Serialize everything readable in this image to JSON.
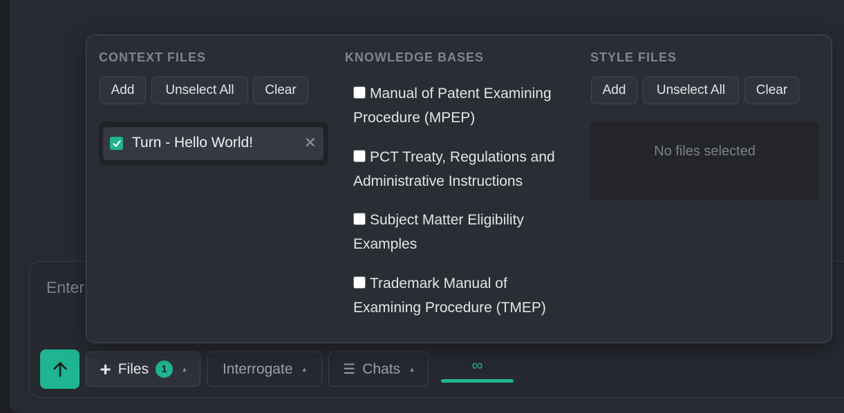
{
  "composer": {
    "placeholder": "Enter"
  },
  "toolbar": {
    "files_label": "Files",
    "files_count": "1",
    "interrogate_label": "Interrogate",
    "chats_label": "Chats",
    "mode_symbol": "∞"
  },
  "context_files": {
    "title": "CONTEXT FILES",
    "buttons": [
      "Add",
      "Unselect All",
      "Clear"
    ],
    "items": [
      {
        "name": "Turn - Hello World!",
        "checked": true
      }
    ]
  },
  "knowledge_bases": {
    "title": "KNOWLEDGE BASES",
    "items": [
      {
        "line1": "Manual of Patent Examining",
        "line2": "Procedure (MPEP)",
        "checked": false
      },
      {
        "line1": "PCT Treaty, Regulations and",
        "line2": "Administrative Instructions",
        "checked": false
      },
      {
        "line1": "Subject Matter Eligibility",
        "line2": "Examples",
        "checked": false
      },
      {
        "line1": "Trademark Manual of",
        "line2": "Examining Procedure (TMEP)",
        "checked": false
      }
    ]
  },
  "style_files": {
    "title": "STYLE FILES",
    "buttons": [
      "Add",
      "Unselect All",
      "Clear"
    ],
    "empty_text": "No files selected"
  },
  "icons": {
    "send": "arrow-up-icon",
    "plus": "plus-icon",
    "chats": "list-icon",
    "remove": "close-icon",
    "mode": "infinity-icon"
  },
  "colors": {
    "accent": "#1fb593",
    "background": "#272a31",
    "panel": "#2a2d34"
  }
}
